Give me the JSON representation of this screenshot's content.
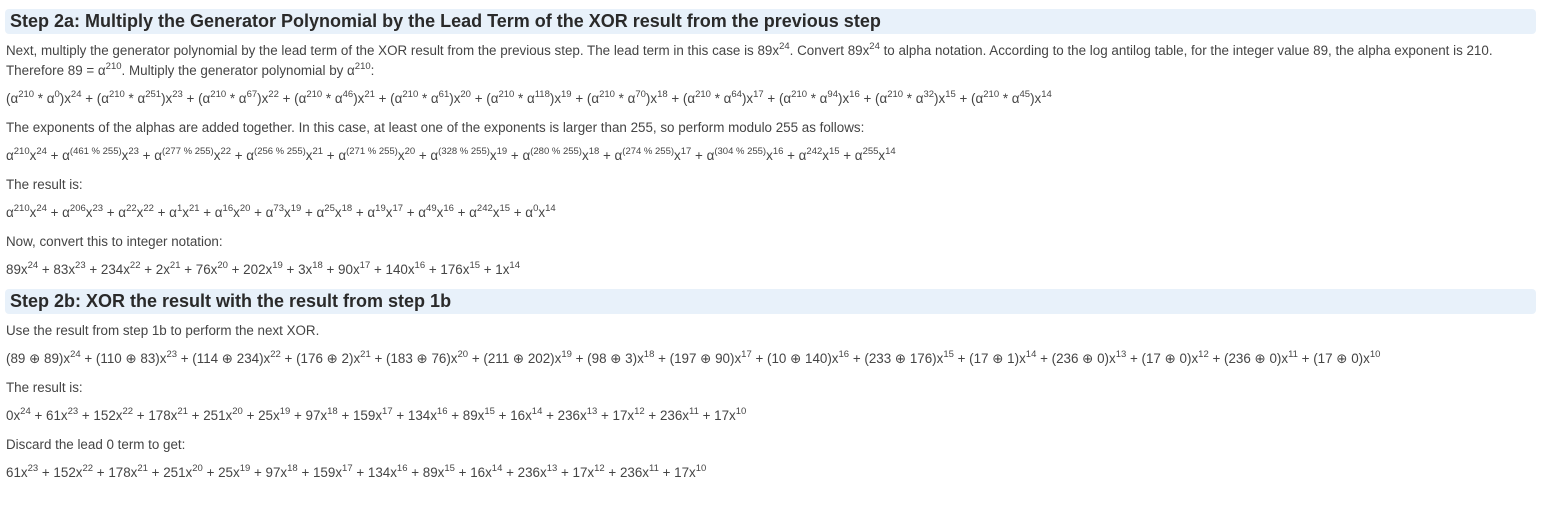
{
  "step2a": {
    "heading": "Step 2a: Multiply the Generator Polynomial by the Lead Term of the XOR result from the previous step",
    "intro": [
      {
        "t": "Next, multiply the generator polynomial by the lead term of the XOR result from the previous step. The lead term in this case is 89x"
      },
      {
        "s": "24"
      },
      {
        "t": ". Convert 89x"
      },
      {
        "s": "24"
      },
      {
        "t": " to alpha notation. According to the log antilog table, for the integer value 89, the alpha exponent is 210. Therefore 89 = α"
      },
      {
        "s": "210"
      },
      {
        "t": ". Multiply the generator polynomial by α"
      },
      {
        "s": "210"
      },
      {
        "t": ":"
      }
    ],
    "multiply_formula": [
      {
        "t": "(α"
      },
      {
        "s": "210"
      },
      {
        "t": " * α"
      },
      {
        "s": "0"
      },
      {
        "t": ")x"
      },
      {
        "s": "24"
      },
      {
        "t": " + (α"
      },
      {
        "s": "210"
      },
      {
        "t": " * α"
      },
      {
        "s": "251"
      },
      {
        "t": ")x"
      },
      {
        "s": "23"
      },
      {
        "t": " + (α"
      },
      {
        "s": "210"
      },
      {
        "t": " * α"
      },
      {
        "s": "67"
      },
      {
        "t": ")x"
      },
      {
        "s": "22"
      },
      {
        "t": " + (α"
      },
      {
        "s": "210"
      },
      {
        "t": " * α"
      },
      {
        "s": "46"
      },
      {
        "t": ")x"
      },
      {
        "s": "21"
      },
      {
        "t": " + (α"
      },
      {
        "s": "210"
      },
      {
        "t": " * α"
      },
      {
        "s": "61"
      },
      {
        "t": ")x"
      },
      {
        "s": "20"
      },
      {
        "t": " + (α"
      },
      {
        "s": "210"
      },
      {
        "t": " * α"
      },
      {
        "s": "118"
      },
      {
        "t": ")x"
      },
      {
        "s": "19"
      },
      {
        "t": " + (α"
      },
      {
        "s": "210"
      },
      {
        "t": " * α"
      },
      {
        "s": "70"
      },
      {
        "t": ")x"
      },
      {
        "s": "18"
      },
      {
        "t": " + (α"
      },
      {
        "s": "210"
      },
      {
        "t": " * α"
      },
      {
        "s": "64"
      },
      {
        "t": ")x"
      },
      {
        "s": "17"
      },
      {
        "t": " + (α"
      },
      {
        "s": "210"
      },
      {
        "t": " * α"
      },
      {
        "s": "94"
      },
      {
        "t": ")x"
      },
      {
        "s": "16"
      },
      {
        "t": " + (α"
      },
      {
        "s": "210"
      },
      {
        "t": " * α"
      },
      {
        "s": "32"
      },
      {
        "t": ")x"
      },
      {
        "s": "15"
      },
      {
        "t": " + (α"
      },
      {
        "s": "210"
      },
      {
        "t": " * α"
      },
      {
        "s": "45"
      },
      {
        "t": ")x"
      },
      {
        "s": "14"
      }
    ],
    "exponents_text": [
      {
        "t": "The exponents of the alphas are added together. In this case, at least one of the exponents is larger than 255, so perform modulo 255 as follows:"
      }
    ],
    "modulo_formula": [
      {
        "t": "α"
      },
      {
        "s": "210"
      },
      {
        "t": "x"
      },
      {
        "s": "24"
      },
      {
        "t": " + α"
      },
      {
        "s": "(461 % 255)"
      },
      {
        "t": "x"
      },
      {
        "s": "23"
      },
      {
        "t": " + α"
      },
      {
        "s": "(277 % 255)"
      },
      {
        "t": "x"
      },
      {
        "s": "22"
      },
      {
        "t": " + α"
      },
      {
        "s": "(256 % 255)"
      },
      {
        "t": "x"
      },
      {
        "s": "21"
      },
      {
        "t": " + α"
      },
      {
        "s": "(271 % 255)"
      },
      {
        "t": "x"
      },
      {
        "s": "20"
      },
      {
        "t": " + α"
      },
      {
        "s": "(328 % 255)"
      },
      {
        "t": "x"
      },
      {
        "s": "19"
      },
      {
        "t": " + α"
      },
      {
        "s": "(280 % 255)"
      },
      {
        "t": "x"
      },
      {
        "s": "18"
      },
      {
        "t": " + α"
      },
      {
        "s": "(274 % 255)"
      },
      {
        "t": "x"
      },
      {
        "s": "17"
      },
      {
        "t": " + α"
      },
      {
        "s": "(304 % 255)"
      },
      {
        "t": "x"
      },
      {
        "s": "16"
      },
      {
        "t": " + α"
      },
      {
        "s": "242"
      },
      {
        "t": "x"
      },
      {
        "s": "15"
      },
      {
        "t": " + α"
      },
      {
        "s": "255"
      },
      {
        "t": "x"
      },
      {
        "s": "14"
      }
    ],
    "result_label": [
      {
        "t": "The result is:"
      }
    ],
    "alpha_result": [
      {
        "t": "α"
      },
      {
        "s": "210"
      },
      {
        "t": "x"
      },
      {
        "s": "24"
      },
      {
        "t": " + α"
      },
      {
        "s": "206"
      },
      {
        "t": "x"
      },
      {
        "s": "23"
      },
      {
        "t": " + α"
      },
      {
        "s": "22"
      },
      {
        "t": "x"
      },
      {
        "s": "22"
      },
      {
        "t": " + α"
      },
      {
        "s": "1"
      },
      {
        "t": "x"
      },
      {
        "s": "21"
      },
      {
        "t": " + α"
      },
      {
        "s": "16"
      },
      {
        "t": "x"
      },
      {
        "s": "20"
      },
      {
        "t": " + α"
      },
      {
        "s": "73"
      },
      {
        "t": "x"
      },
      {
        "s": "19"
      },
      {
        "t": " + α"
      },
      {
        "s": "25"
      },
      {
        "t": "x"
      },
      {
        "s": "18"
      },
      {
        "t": " + α"
      },
      {
        "s": "19"
      },
      {
        "t": "x"
      },
      {
        "s": "17"
      },
      {
        "t": " + α"
      },
      {
        "s": "49"
      },
      {
        "t": "x"
      },
      {
        "s": "16"
      },
      {
        "t": " + α"
      },
      {
        "s": "242"
      },
      {
        "t": "x"
      },
      {
        "s": "15"
      },
      {
        "t": " + α"
      },
      {
        "s": "0"
      },
      {
        "t": "x"
      },
      {
        "s": "14"
      }
    ],
    "convert_label": [
      {
        "t": "Now, convert this to integer notation:"
      }
    ],
    "integer_result": [
      {
        "t": "89x"
      },
      {
        "s": "24"
      },
      {
        "t": " + 83x"
      },
      {
        "s": "23"
      },
      {
        "t": " + 234x"
      },
      {
        "s": "22"
      },
      {
        "t": " + 2x"
      },
      {
        "s": "21"
      },
      {
        "t": " + 76x"
      },
      {
        "s": "20"
      },
      {
        "t": " + 202x"
      },
      {
        "s": "19"
      },
      {
        "t": " + 3x"
      },
      {
        "s": "18"
      },
      {
        "t": " + 90x"
      },
      {
        "s": "17"
      },
      {
        "t": " + 140x"
      },
      {
        "s": "16"
      },
      {
        "t": " + 176x"
      },
      {
        "s": "15"
      },
      {
        "t": " + 1x"
      },
      {
        "s": "14"
      }
    ]
  },
  "step2b": {
    "heading": "Step 2b: XOR the result with the result from step 1b",
    "intro": [
      {
        "t": "Use the result from step 1b to perform the next XOR."
      }
    ],
    "xor_formula": [
      {
        "t": "(89 ⊕ 89)x"
      },
      {
        "s": "24"
      },
      {
        "t": " + (110 ⊕ 83)x"
      },
      {
        "s": "23"
      },
      {
        "t": " + (114 ⊕ 234)x"
      },
      {
        "s": "22"
      },
      {
        "t": " + (176 ⊕ 2)x"
      },
      {
        "s": "21"
      },
      {
        "t": " + (183 ⊕ 76)x"
      },
      {
        "s": "20"
      },
      {
        "t": " + (211 ⊕ 202)x"
      },
      {
        "s": "19"
      },
      {
        "t": " + (98 ⊕ 3)x"
      },
      {
        "s": "18"
      },
      {
        "t": " + (197 ⊕ 90)x"
      },
      {
        "s": "17"
      },
      {
        "t": " + (10 ⊕ 140)x"
      },
      {
        "s": "16"
      },
      {
        "t": " + (233 ⊕ 176)x"
      },
      {
        "s": "15"
      },
      {
        "t": " + (17 ⊕ 1)x"
      },
      {
        "s": "14"
      },
      {
        "t": " + (236 ⊕ 0)x"
      },
      {
        "s": "13"
      },
      {
        "t": " + (17 ⊕ 0)x"
      },
      {
        "s": "12"
      },
      {
        "t": " + (236 ⊕ 0)x"
      },
      {
        "s": "11"
      },
      {
        "t": " + (17 ⊕ 0)x"
      },
      {
        "s": "10"
      }
    ],
    "result_label": [
      {
        "t": "The result is:"
      }
    ],
    "xor_result": [
      {
        "t": "0x"
      },
      {
        "s": "24"
      },
      {
        "t": " + 61x"
      },
      {
        "s": "23"
      },
      {
        "t": " + 152x"
      },
      {
        "s": "22"
      },
      {
        "t": " + 178x"
      },
      {
        "s": "21"
      },
      {
        "t": " + 251x"
      },
      {
        "s": "20"
      },
      {
        "t": " + 25x"
      },
      {
        "s": "19"
      },
      {
        "t": " + 97x"
      },
      {
        "s": "18"
      },
      {
        "t": " + 159x"
      },
      {
        "s": "17"
      },
      {
        "t": " + 134x"
      },
      {
        "s": "16"
      },
      {
        "t": " + 89x"
      },
      {
        "s": "15"
      },
      {
        "t": " + 16x"
      },
      {
        "s": "14"
      },
      {
        "t": " + 236x"
      },
      {
        "s": "13"
      },
      {
        "t": " + 17x"
      },
      {
        "s": "12"
      },
      {
        "t": " + 236x"
      },
      {
        "s": "11"
      },
      {
        "t": " + 17x"
      },
      {
        "s": "10"
      }
    ],
    "discard_label": [
      {
        "t": "Discard the lead 0 term to get:"
      }
    ],
    "final_result": [
      {
        "t": "61x"
      },
      {
        "s": "23"
      },
      {
        "t": " + 152x"
      },
      {
        "s": "22"
      },
      {
        "t": " + 178x"
      },
      {
        "s": "21"
      },
      {
        "t": " + 251x"
      },
      {
        "s": "20"
      },
      {
        "t": " + 25x"
      },
      {
        "s": "19"
      },
      {
        "t": " + 97x"
      },
      {
        "s": "18"
      },
      {
        "t": " + 159x"
      },
      {
        "s": "17"
      },
      {
        "t": " + 134x"
      },
      {
        "s": "16"
      },
      {
        "t": " + 89x"
      },
      {
        "s": "15"
      },
      {
        "t": " + 16x"
      },
      {
        "s": "14"
      },
      {
        "t": " + 236x"
      },
      {
        "s": "13"
      },
      {
        "t": " + 17x"
      },
      {
        "s": "12"
      },
      {
        "t": " + 236x"
      },
      {
        "s": "11"
      },
      {
        "t": " + 17x"
      },
      {
        "s": "10"
      }
    ]
  }
}
